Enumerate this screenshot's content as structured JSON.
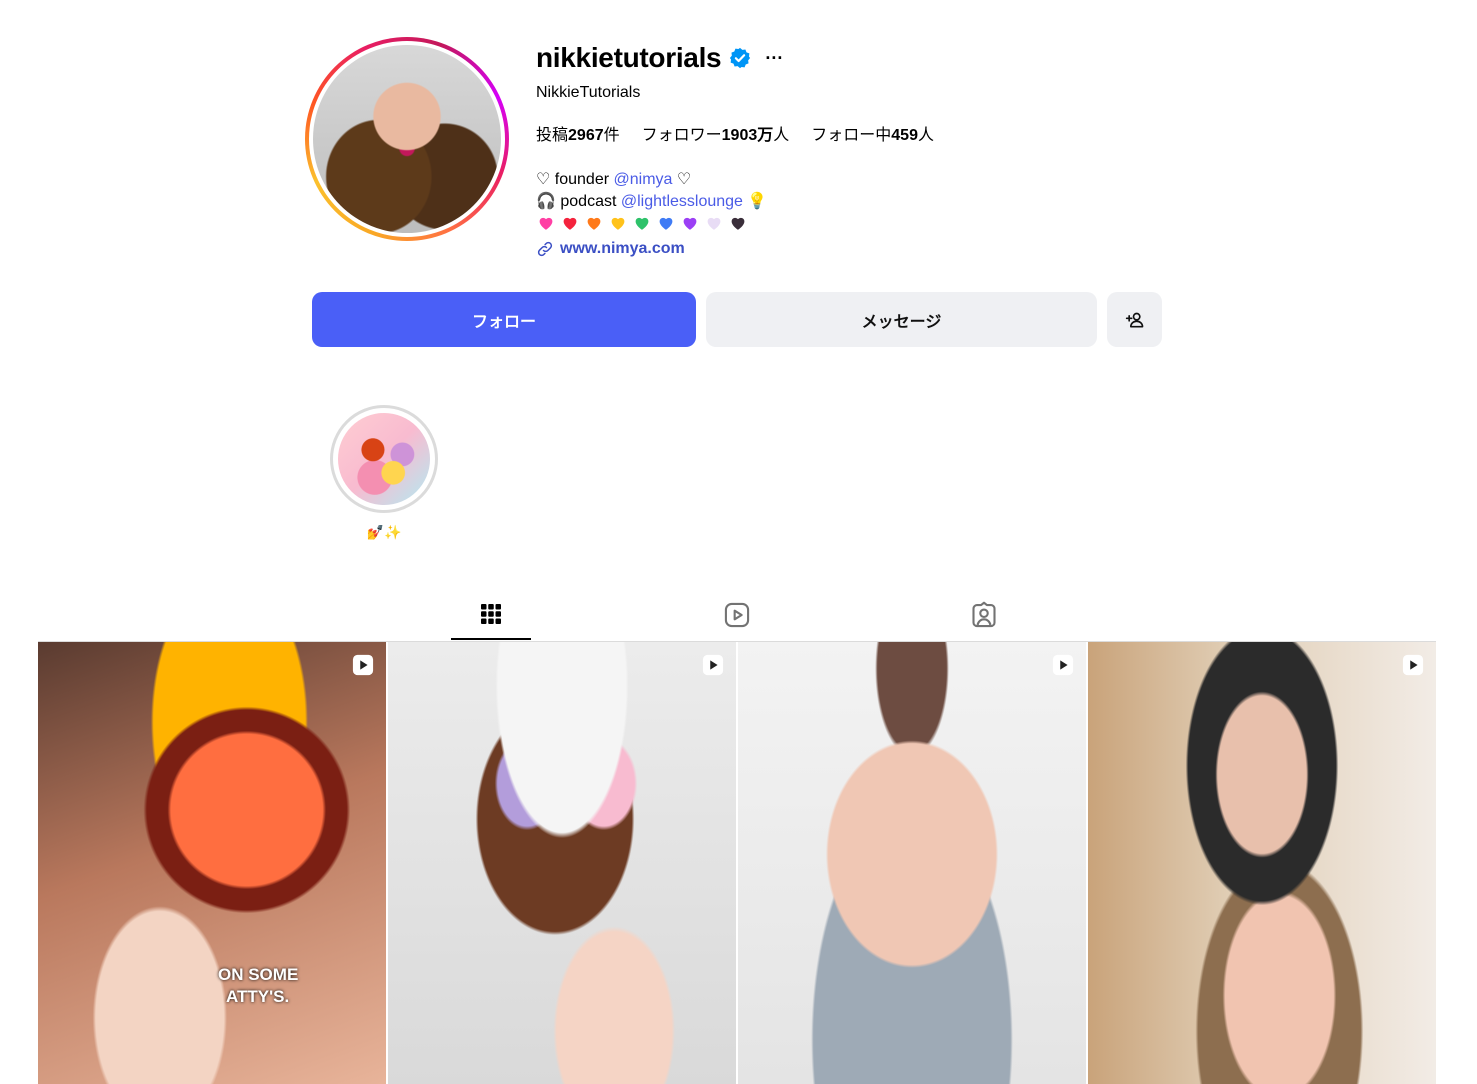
{
  "profile": {
    "username": "nikkietutorials",
    "full_name": "NikkieTutorials",
    "more_label": "···",
    "stats": {
      "posts_label": "投稿",
      "posts_count": "2967",
      "posts_suffix": "件",
      "followers_label": "フォロワー",
      "followers_count": "1903万",
      "followers_suffix": "人",
      "following_label": "フォロー中",
      "following_count": "459",
      "following_suffix": "人"
    },
    "bio": {
      "line1_prefix": "♡ founder ",
      "line1_mention": "@nimya",
      "line1_suffix": " ♡",
      "line2_prefix": "🎧  podcast ",
      "line2_mention": "@lightlesslounge",
      "line2_suffix": " 💡"
    },
    "hearts_colors": [
      "#ff3fa4",
      "#f4233d",
      "#ff7a1a",
      "#ffc21a",
      "#2ec26a",
      "#3f7bf5",
      "#9b3ff5",
      "#e8dcf5",
      "#3a2e3a"
    ],
    "website": "www.nimya.com"
  },
  "actions": {
    "follow_label": "フォロー",
    "message_label": "メッセージ"
  },
  "highlights": [
    {
      "label": "💅✨"
    }
  ],
  "posts": [
    {
      "caption_line1": "ON SOME",
      "caption_line2": "ATTY'S."
    },
    {
      "caption_line1": "",
      "caption_line2": ""
    },
    {
      "caption_line1": "",
      "caption_line2": ""
    },
    {
      "caption_line1": "",
      "caption_line2": ""
    }
  ],
  "colors": {
    "accent": "#4a5ff7",
    "verified": "#0095f6",
    "link": "#3b4fc4"
  }
}
